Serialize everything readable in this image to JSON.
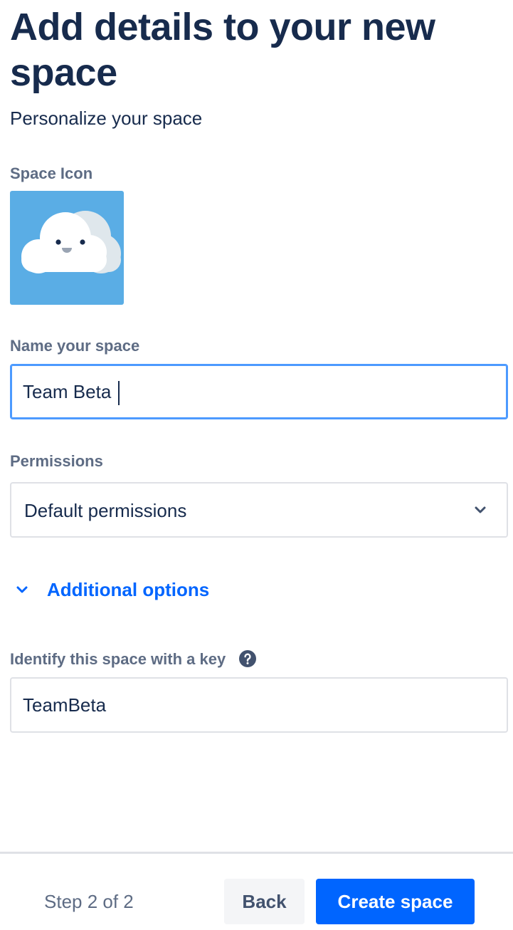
{
  "header": {
    "title": "Add details to your new space",
    "subtitle": "Personalize your space"
  },
  "space_icon": {
    "label": "Space Icon",
    "icon": "smiling-cloud-icon",
    "background_color": "#5aade5"
  },
  "name_field": {
    "label": "Name your space",
    "value": "Team Beta"
  },
  "permissions": {
    "label": "Permissions",
    "selected": "Default permissions"
  },
  "additional_options": {
    "label": "Additional options"
  },
  "key_field": {
    "label": "Identify this space with a key",
    "value": "TeamBeta"
  },
  "footer": {
    "step": "Step 2 of 2",
    "back_label": "Back",
    "create_label": "Create space"
  },
  "colors": {
    "primary": "#0065ff",
    "heading": "#172b4d",
    "muted": "#5e6c84",
    "focus_border": "#4c9aff"
  }
}
